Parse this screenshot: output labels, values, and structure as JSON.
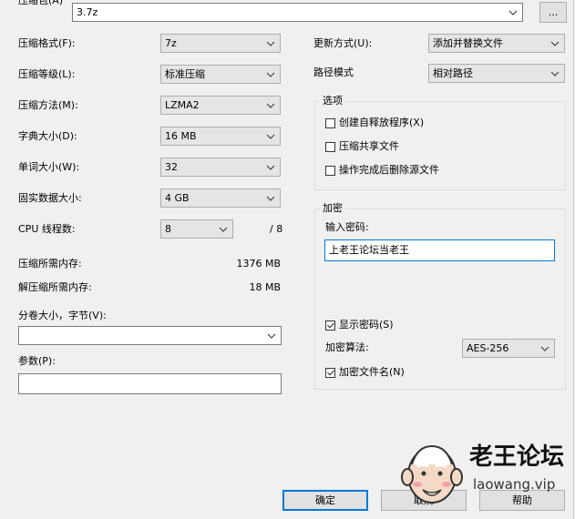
{
  "archive": {
    "label": "压缩包(A)",
    "value": "3.7z",
    "browse_label": "..."
  },
  "left": {
    "format": {
      "label": "压缩格式(F):",
      "value": "7z"
    },
    "level": {
      "label": "压缩等级(L):",
      "value": "标准压缩"
    },
    "method": {
      "label": "压缩方法(M):",
      "value": "LZMA2"
    },
    "dict": {
      "label": "字典大小(D):",
      "value": "16 MB"
    },
    "word": {
      "label": "单词大小(W):",
      "value": "32"
    },
    "solid": {
      "label": "固实数据大小:",
      "value": "4 GB"
    },
    "threads": {
      "label": "CPU 线程数:",
      "value": "8",
      "max": "/ 8"
    },
    "mem_compress": {
      "label": "压缩所需内存:",
      "value": "1376 MB"
    },
    "mem_decompress": {
      "label": "解压缩所需内存:",
      "value": "18 MB"
    },
    "split": {
      "label": "分卷大小，字节(V):",
      "value": ""
    },
    "params": {
      "label": "参数(P):",
      "value": ""
    }
  },
  "right": {
    "update": {
      "label": "更新方式(U):",
      "value": "添加并替换文件"
    },
    "pathmode": {
      "label": "路径模式",
      "value": "相对路径"
    },
    "options": {
      "title": "选项",
      "items": [
        {
          "label": "创建自释放程序(X)",
          "checked": false
        },
        {
          "label": "压缩共享文件",
          "checked": false
        },
        {
          "label": "操作完成后删除源文件",
          "checked": false
        }
      ]
    },
    "encryption": {
      "title": "加密",
      "password_label": "输入密码:",
      "password_value": "上老王论坛当老王",
      "show_password": {
        "label": "显示密码(S)",
        "checked": true
      },
      "method_label": "加密算法:",
      "method_value": "AES-256",
      "encrypt_names": {
        "label": "加密文件名(N)",
        "checked": true
      }
    }
  },
  "buttons": {
    "ok": "确定",
    "cancel": "取消",
    "help": "帮助"
  },
  "watermark": {
    "title": "老王论坛",
    "site": "laowang.vip"
  }
}
